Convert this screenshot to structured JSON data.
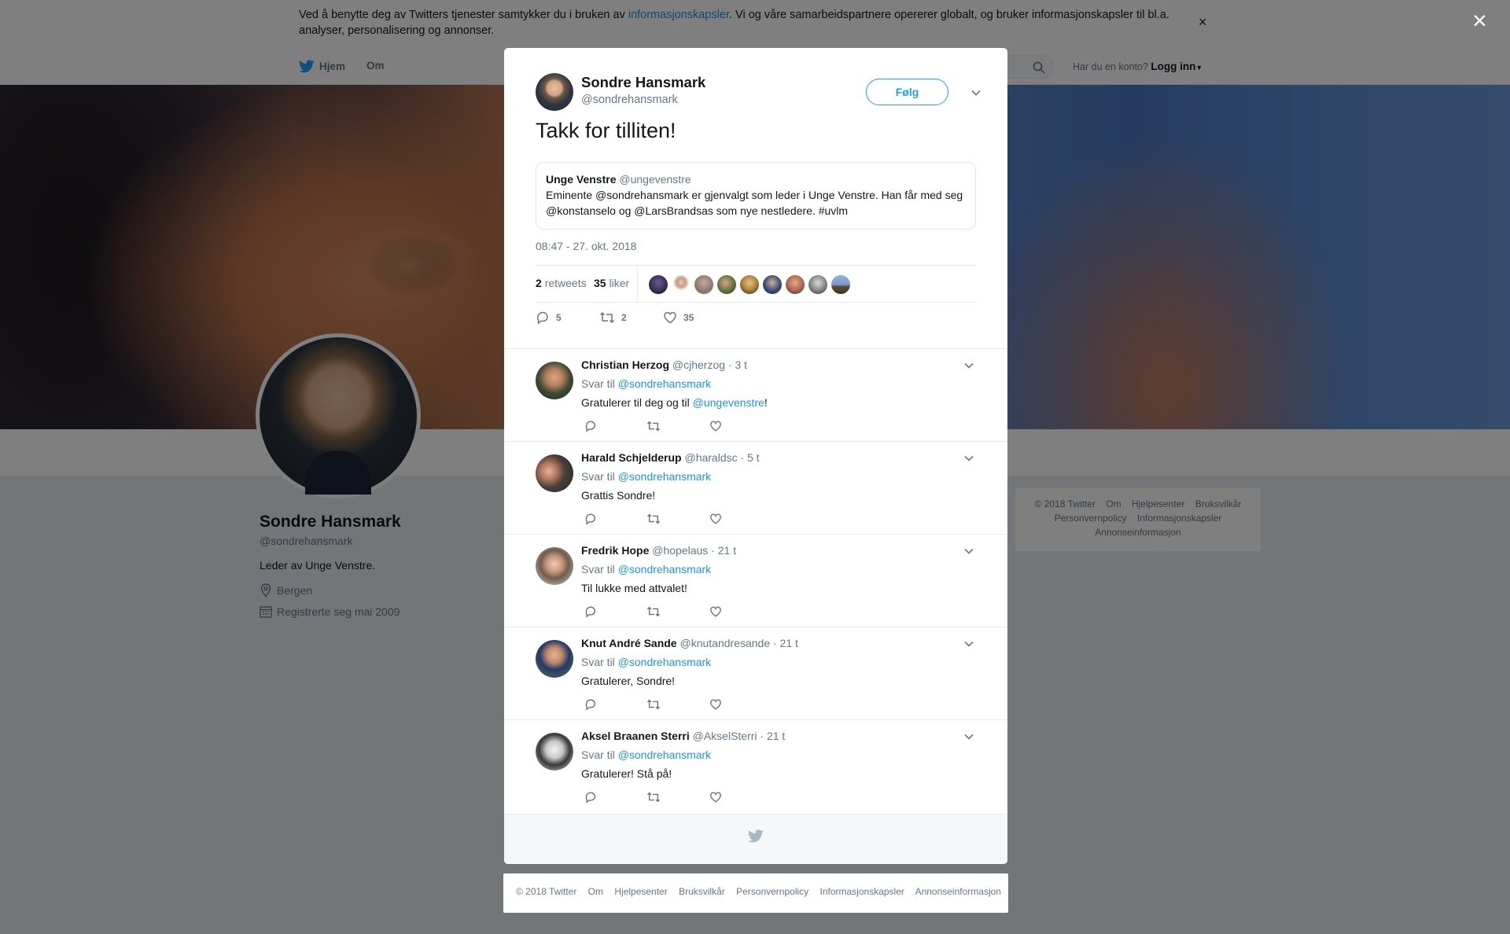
{
  "cookie_bar": {
    "text_before": "Ved å benytte deg av Twitters tjenester samtykker du i bruken av ",
    "link": "informasjonskapsler",
    "text_after": ". Vi og våre samarbeidspartnere opererer globalt, og bruker informasjonskapsler til bl.a. analyser, personalisering og annonser.",
    "close": "×"
  },
  "topnav": {
    "home": "Hjem",
    "about": "Om",
    "login_prompt": "Har du en konto?",
    "login": "Logg inn"
  },
  "profile": {
    "name": "Sondre Hansmark",
    "handle": "@sondrehansmark",
    "bio": "Leder av Unge Venstre.",
    "location": "Bergen",
    "joined": "Registrerte seg mai 2009"
  },
  "side_footer": {
    "items": [
      "© 2018 Twitter",
      "Om",
      "Hjelpesenter",
      "Bruksvilkår",
      "Personvernpolicy",
      "Informasjonskapsler",
      "Annonseinformasjon"
    ]
  },
  "overlay_close": "×",
  "tweet": {
    "author_name": "Sondre Hansmark",
    "author_handle": "@sondrehansmark",
    "follow_label": "Følg",
    "text": "Takk for tilliten!",
    "quote": {
      "name": "Unge Venstre",
      "handle": "@ungevenstre",
      "text": "Eminente @sondrehansmark er gjenvalgt som leder i Unge Venstre. Han får med seg @konstanselo og @LarsBrandsas som nye nestledere. #uvlm"
    },
    "timestamp": "08:47 - 27. okt. 2018",
    "retweets_count": "2",
    "retweets_label": "retweets",
    "likes_count": "35",
    "likes_label": "liker",
    "actions": {
      "replies": "5",
      "retweets": "2",
      "likes": "35"
    }
  },
  "replies": [
    {
      "name": "Christian Herzog",
      "handle": "@cjherzog",
      "time": "· 3 t",
      "reply_to_label": "Svar til",
      "reply_to": "@sondrehansmark",
      "text_before": "Gratulerer til deg og til ",
      "mention": "@ungevenstre",
      "text_after": "!"
    },
    {
      "name": "Harald Schjelderup",
      "handle": "@haraldsc",
      "time": "· 5 t",
      "reply_to_label": "Svar til",
      "reply_to": "@sondrehansmark",
      "text_before": "Grattis Sondre!",
      "mention": "",
      "text_after": ""
    },
    {
      "name": "Fredrik Hope",
      "handle": "@hopelaus",
      "time": "· 21 t",
      "reply_to_label": "Svar til",
      "reply_to": "@sondrehansmark",
      "text_before": "Til lukke med attvalet!",
      "mention": "",
      "text_after": ""
    },
    {
      "name": "Knut André Sande",
      "handle": "@knutandresande",
      "time": "· 21 t",
      "reply_to_label": "Svar til",
      "reply_to": "@sondrehansmark",
      "text_before": "Gratulerer, Sondre!",
      "mention": "",
      "text_after": ""
    },
    {
      "name": "Aksel Braanen Sterri",
      "handle": "@AkselSterri",
      "time": "· 21 t",
      "reply_to_label": "Svar til",
      "reply_to": "@sondrehansmark",
      "text_before": "Gratulerer! Stå på!",
      "mention": "",
      "text_after": ""
    }
  ],
  "bottom_footer": {
    "items": [
      "© 2018 Twitter",
      "Om",
      "Hjelpesenter",
      "Bruksvilkår",
      "Personvernpolicy",
      "Informasjonskapsler",
      "Annonseinformasjon"
    ]
  },
  "colors": {
    "accent": "#1da1f2",
    "link": "#1b95e0",
    "muted": "#657786",
    "overlay": "rgba(0,0,0,0.5)"
  }
}
